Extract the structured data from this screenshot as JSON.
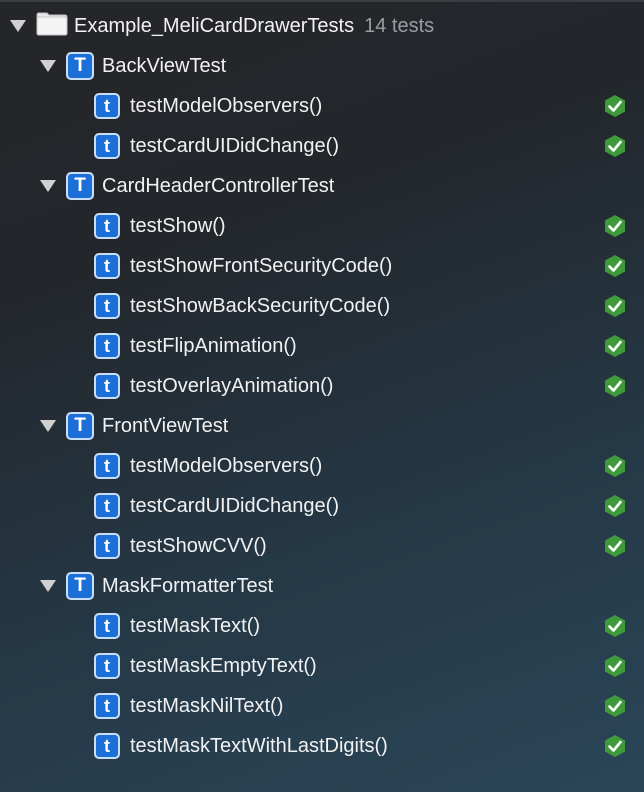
{
  "root": {
    "title": "Example_MeliCardDrawerTests",
    "count": "14 tests"
  },
  "suites": [
    {
      "name": "BackViewTest",
      "tests": [
        "testModelObservers()",
        "testCardUIDidChange()"
      ]
    },
    {
      "name": "CardHeaderControllerTest",
      "tests": [
        "testShow()",
        "testShowFrontSecurityCode()",
        "testShowBackSecurityCode()",
        "testFlipAnimation()",
        "testOverlayAnimation()"
      ]
    },
    {
      "name": "FrontViewTest",
      "tests": [
        "testModelObservers()",
        "testCardUIDidChange()",
        "testShowCVV()"
      ]
    },
    {
      "name": "MaskFormatterTest",
      "tests": [
        "testMaskText()",
        "testMaskEmptyText()",
        "testMaskNilText()",
        "testMaskTextWithLastDigits()"
      ]
    }
  ],
  "icons": {
    "suite_glyph": "T",
    "case_glyph": "t",
    "folder": "folder-icon",
    "pass": "passed-check-icon",
    "disclosure": "disclosure-triangle-icon"
  },
  "colors": {
    "test_icon_blue": "#1d6fd8",
    "pass_green": "#3f9b3a",
    "secondary_text": "#9a9da1"
  }
}
